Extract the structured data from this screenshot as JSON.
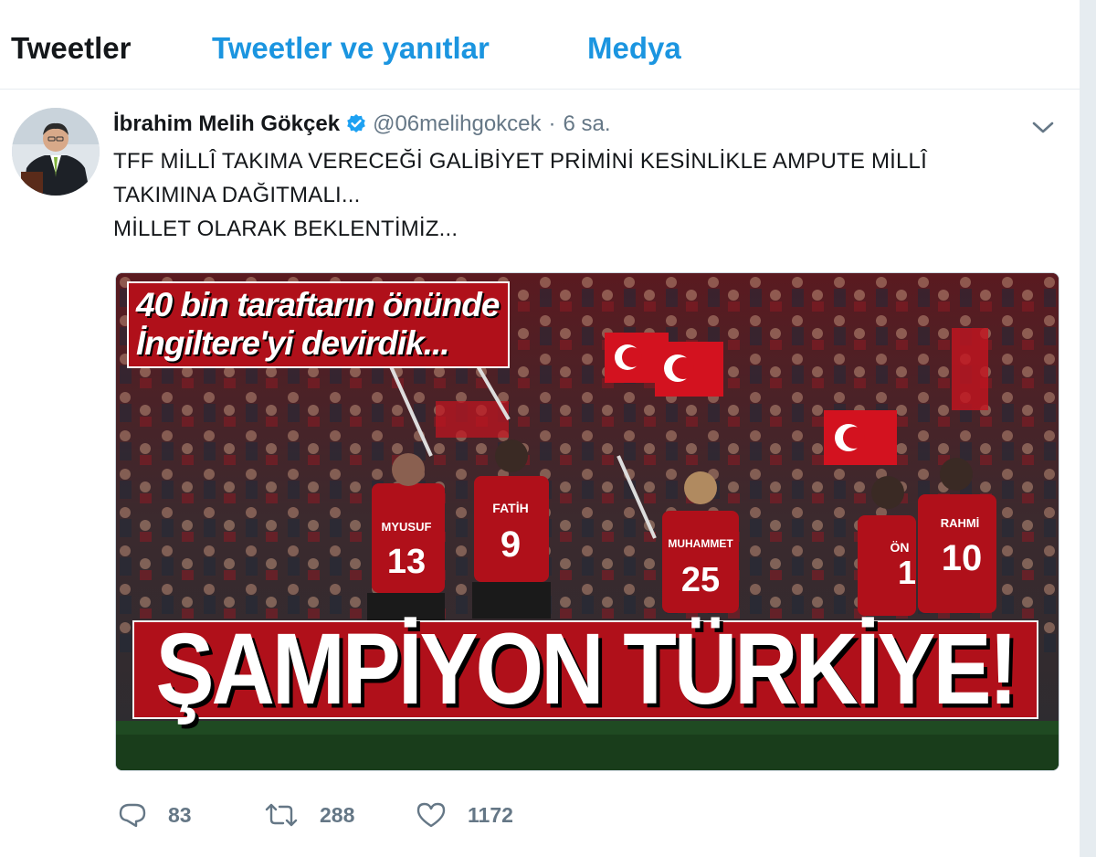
{
  "tabs": [
    {
      "label": "Tweetler",
      "active": true
    },
    {
      "label": "Tweetler ve yanıtlar",
      "active": false
    },
    {
      "label": "Medya",
      "active": false
    }
  ],
  "tweet": {
    "name": "İbrahim Melih Gökçek",
    "handle": "@06melihgokcek",
    "separator": "·",
    "time": "6 sa.",
    "text_lines": [
      "TFF MİLLÎ TAKIMA VERECEĞİ GALİBİYET PRİMİNİ KESİNLİKLE AMPUTE MİLLÎ",
      "TAKIMINA DAĞITMALI...",
      "MİLLET OLARAK BEKLENTİMİZ..."
    ],
    "media": {
      "headline_line1": "40 bin taraftarın önünde",
      "headline_line2": "İngiltere'yi devirdik...",
      "banner": "ŞAMPİYON TÜRKİYE!",
      "jerseys": [
        {
          "name": "MYUSUF",
          "number": "13"
        },
        {
          "name": "FATİH",
          "number": "9"
        },
        {
          "name": "MUHAMMET",
          "number": "25"
        },
        {
          "name": "ÖN",
          "number": "1"
        },
        {
          "name": "RAHMİ",
          "number": "10"
        }
      ]
    },
    "actions": {
      "replies": "83",
      "retweets": "288",
      "likes": "1172"
    }
  },
  "colors": {
    "link": "#1b95e0",
    "muted": "#657786",
    "jersey_red": "#b0101a"
  }
}
